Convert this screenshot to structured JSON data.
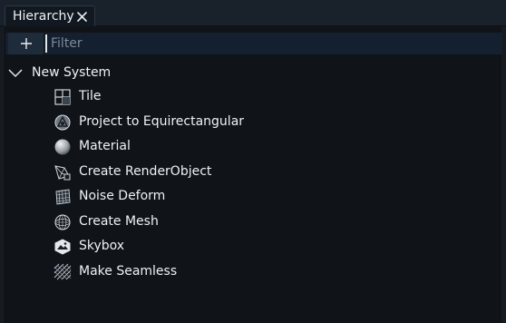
{
  "tab": {
    "title": "Hierarchy"
  },
  "toolbar": {
    "add_label": "+",
    "filter_placeholder": "Filter"
  },
  "tree": {
    "root": {
      "label": "New System",
      "expanded": true
    },
    "items": [
      {
        "label": "Tile",
        "icon": "tile-grid-icon"
      },
      {
        "label": "Project to Equirectangular",
        "icon": "projection-sphere-icon"
      },
      {
        "label": "Material",
        "icon": "material-sphere-icon"
      },
      {
        "label": "Create RenderObject",
        "icon": "render-object-icon"
      },
      {
        "label": "Noise Deform",
        "icon": "noise-deform-icon"
      },
      {
        "label": "Create Mesh",
        "icon": "mesh-sphere-icon"
      },
      {
        "label": "Skybox",
        "icon": "skybox-icon"
      },
      {
        "label": "Make Seamless",
        "icon": "seamless-pattern-icon"
      }
    ]
  },
  "colors": {
    "panel": "#101419",
    "toolbar": "#162030",
    "text": "#eef2f5",
    "placeholder": "#7d8a97"
  }
}
